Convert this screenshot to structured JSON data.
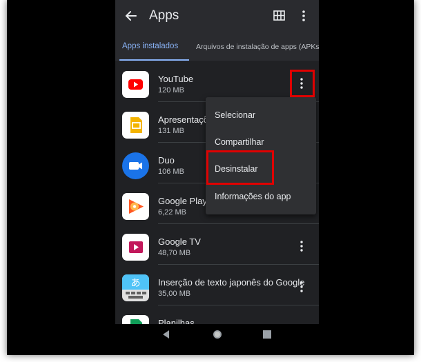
{
  "appbar": {
    "title": "Apps",
    "back_icon": "arrow-left-icon",
    "grid_icon": "grid-view-icon",
    "more_icon": "more-vert-icon"
  },
  "tabs": [
    {
      "label": "Apps instalados",
      "selected": true
    },
    {
      "label": "Arquivos de instalação de apps (APKs)",
      "selected": false
    }
  ],
  "apps": [
    {
      "name": "YouTube",
      "size": "120 MB",
      "icon": "youtube-icon"
    },
    {
      "name": "Apresentações Google",
      "size": "131 MB",
      "icon": "google-slides-icon"
    },
    {
      "name": "Duo",
      "size": "106 MB",
      "icon": "duo-icon"
    },
    {
      "name": "Google Play Música",
      "size": "6,22 MB",
      "icon": "google-play-music-icon"
    },
    {
      "name": "Google TV",
      "size": "48,70 MB",
      "icon": "google-tv-icon"
    },
    {
      "name": "Inserção de texto japonês do Google",
      "size": "35,00 MB",
      "icon": "japanese-input-icon"
    },
    {
      "name": "Planilhas",
      "size": "",
      "icon": "google-sheets-icon"
    }
  ],
  "context_menu": {
    "items": [
      "Selecionar",
      "Compartilhar",
      "Desinstalar",
      "Informações do app"
    ],
    "highlighted": "Desinstalar"
  },
  "navbar": {
    "icons": [
      "back-triangle-icon",
      "home-circle-icon",
      "recents-square-icon"
    ]
  },
  "colors": {
    "background": "#202124",
    "appbar": "#2a2b2f",
    "accent": "#8ab4f8",
    "highlight_box": "#e00000",
    "menu": "#2f3033"
  }
}
